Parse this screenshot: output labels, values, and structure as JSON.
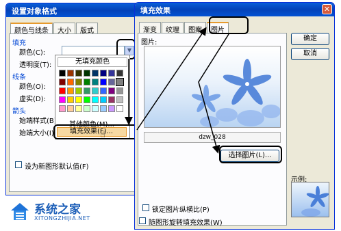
{
  "format_dialog": {
    "title": "设置对象格式",
    "tabs": [
      "颜色与线条",
      "大小",
      "版式"
    ],
    "fill_section": "填充",
    "color_label": "颜色(C):",
    "transparency_label": "透明度(T):",
    "line_section": "线条",
    "line_color_label": "颜色(O):",
    "dash_label": "虚实(D):",
    "arrow_section": "箭头",
    "begin_style_label": "始端样式(B):",
    "begin_size_label": "始端大小(I):",
    "default_checkbox": "设为新图形默认值(F)"
  },
  "color_dropdown": {
    "no_fill": "无填充颜色",
    "more_colors": "其他颜色(M)...",
    "fill_effects": "填充效果(F)...",
    "palette": [
      [
        "#000000",
        "#993300",
        "#333300",
        "#003300",
        "#003366",
        "#000080",
        "#333399",
        "#333333"
      ],
      [
        "#800000",
        "#ff6600",
        "#808000",
        "#008000",
        "#008080",
        "#0000ff",
        "#666699",
        "#808080"
      ],
      [
        "#ff0000",
        "#ff9900",
        "#99cc00",
        "#339966",
        "#33cccc",
        "#3366ff",
        "#800080",
        "#969696"
      ],
      [
        "#ff00ff",
        "#ffcc00",
        "#ffff00",
        "#00ff00",
        "#00ffff",
        "#00ccff",
        "#993366",
        "#c0c0c0"
      ],
      [
        "#ff99cc",
        "#ffcc99",
        "#ffff99",
        "#ccffcc",
        "#ccffff",
        "#99ccff",
        "#cc99ff",
        "#ffffff"
      ]
    ]
  },
  "fill_dialog": {
    "title": "填充效果",
    "tabs": [
      "渐变",
      "纹理",
      "图案",
      "图片"
    ],
    "picture_label": "图片:",
    "filename": "dzw_028",
    "select_picture": "选择图片(L)...",
    "ok": "确定",
    "cancel": "取消",
    "sample_label": "示例:",
    "lock_ratio": "锁定图片纵横比(P)",
    "rotate_with_shape": "随图形旋转填充效果(W)"
  },
  "watermark": {
    "brand": "系统之家",
    "url": "XITONGZHIJIA.NET"
  },
  "colors": {
    "title_blue": "#0442b8",
    "dialog_bg": "#ece9d8",
    "accent_orange": "#e69a2e"
  }
}
